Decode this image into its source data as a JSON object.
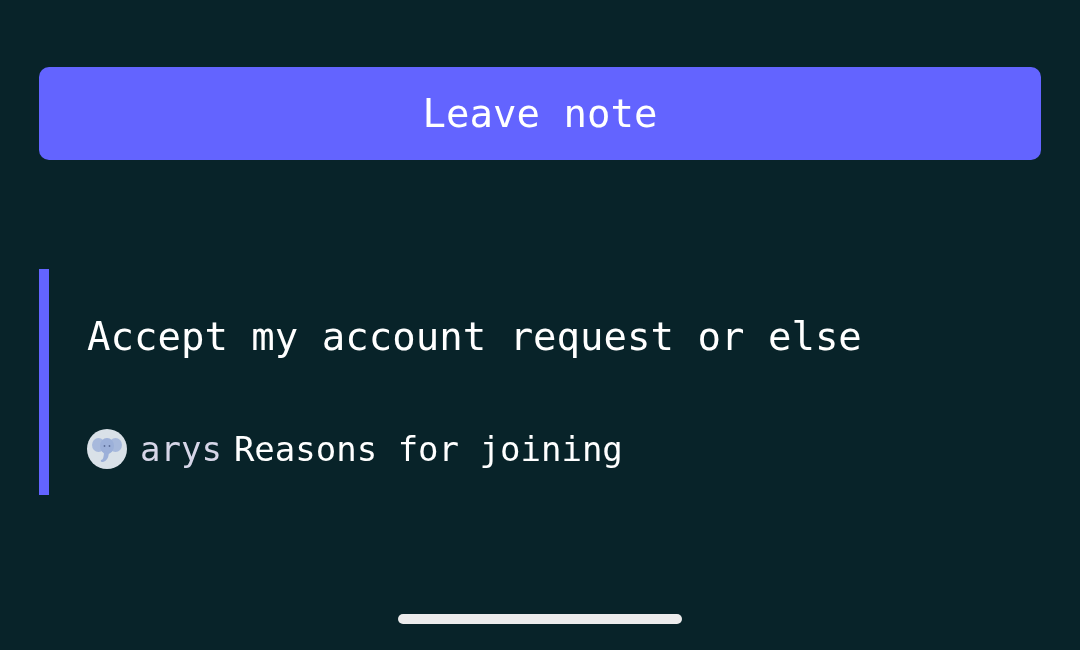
{
  "leave_note_button": {
    "label": "Leave note"
  },
  "note": {
    "text": "Accept my account request or else",
    "author": {
      "username": "arys"
    },
    "reason": "Reasons for joining"
  }
}
